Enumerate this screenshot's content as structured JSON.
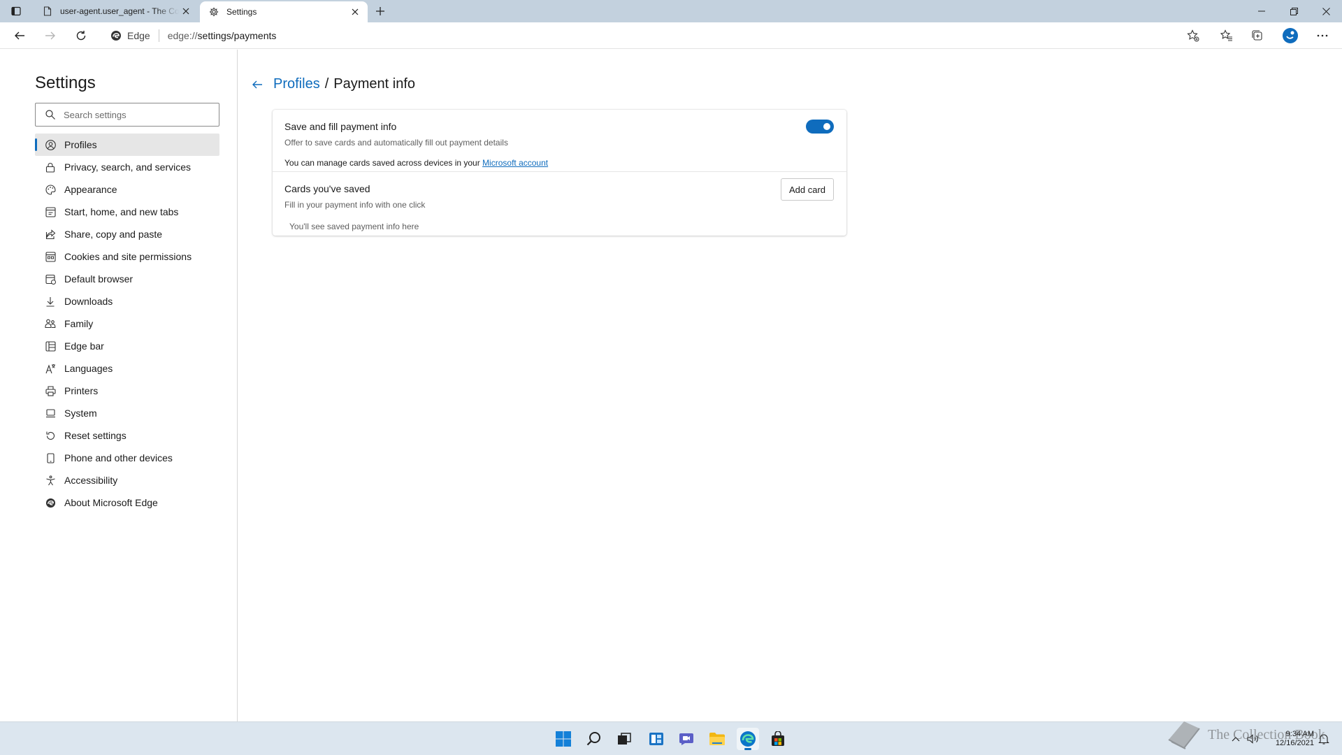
{
  "browser": {
    "tabs": [
      {
        "title": "user-agent.user_agent - The Coll",
        "active": false,
        "icon": "document-icon"
      },
      {
        "title": "Settings",
        "active": true,
        "icon": "gear-icon"
      }
    ],
    "omnibox": {
      "site_label": "Edge",
      "url_scheme": "edge://",
      "url_path": "settings/payments"
    }
  },
  "sidebar": {
    "title": "Settings",
    "search_placeholder": "Search settings",
    "items": [
      {
        "label": "Profiles",
        "icon": "profile-icon",
        "selected": true
      },
      {
        "label": "Privacy, search, and services",
        "icon": "lock-icon"
      },
      {
        "label": "Appearance",
        "icon": "appearance-icon"
      },
      {
        "label": "Start, home, and new tabs",
        "icon": "start-icon"
      },
      {
        "label": "Share, copy and paste",
        "icon": "share-icon"
      },
      {
        "label": "Cookies and site permissions",
        "icon": "cookies-icon"
      },
      {
        "label": "Default browser",
        "icon": "browser-icon"
      },
      {
        "label": "Downloads",
        "icon": "download-icon"
      },
      {
        "label": "Family",
        "icon": "family-icon"
      },
      {
        "label": "Edge bar",
        "icon": "edge-bar-icon"
      },
      {
        "label": "Languages",
        "icon": "languages-icon"
      },
      {
        "label": "Printers",
        "icon": "printer-icon"
      },
      {
        "label": "System",
        "icon": "system-icon"
      },
      {
        "label": "Reset settings",
        "icon": "reset-icon"
      },
      {
        "label": "Phone and other devices",
        "icon": "phone-icon"
      },
      {
        "label": "Accessibility",
        "icon": "accessibility-icon"
      },
      {
        "label": "About Microsoft Edge",
        "icon": "edge-logo-icon"
      }
    ]
  },
  "main": {
    "breadcrumb": {
      "parent": "Profiles",
      "separator": "/",
      "current": "Payment info"
    },
    "save_fill": {
      "title": "Save and fill payment info",
      "description": "Offer to save cards and automatically fill out payment details",
      "note_prefix": "You can manage cards saved across devices in your",
      "link_text": "Microsoft account",
      "enabled": true
    },
    "saved_cards": {
      "title": "Cards you've saved",
      "description": "Fill in your payment info with one click",
      "add_button": "Add card",
      "empty_text": "You'll see saved payment info here"
    }
  },
  "taskbar": {
    "watermark_text": "The Collection Book",
    "time": "9:34 AM",
    "date": "12/16/2021"
  },
  "colors": {
    "accent": "#0f6cbd",
    "tabstrip": "#c3d1de",
    "taskbar": "#dce6ef"
  }
}
